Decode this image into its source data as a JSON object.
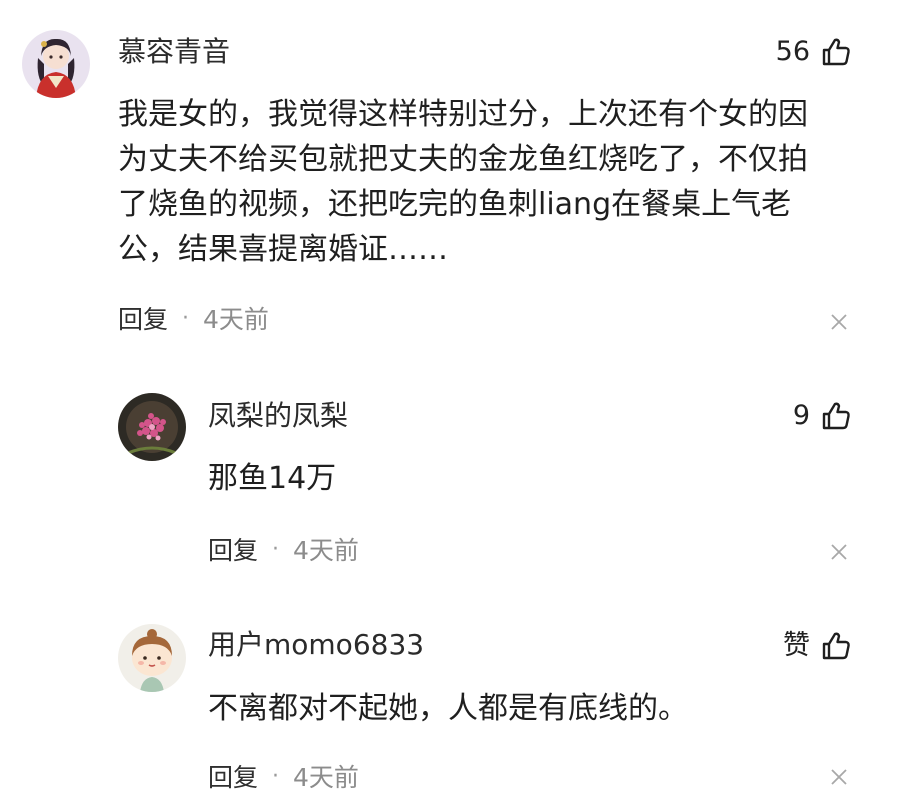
{
  "comments": [
    {
      "username": "慕容青音",
      "likes": "56",
      "lines": [
        "我是女的，我觉得这样特别过分，上次还有个女的因",
        "为丈夫不给买包就把丈夫的金龙鱼红烧吃了，不仅拍",
        "了烧鱼的视频，还把吃完的鱼刺liang在餐桌上气老",
        "公，结果喜提离婚证……"
      ],
      "reply_label": "回复",
      "separator": "·",
      "time": "4天前",
      "avatar_icon": "anime-girl-avatar"
    },
    {
      "username": "凤梨的凤梨",
      "likes": "9",
      "lines": [
        "那鱼14万"
      ],
      "reply_label": "回复",
      "separator": "·",
      "time": "4天前",
      "avatar_icon": "flower-avatar"
    },
    {
      "username": "用户momo6833",
      "likes": "赞",
      "lines": [
        "不离都对不起她，人都是有底线的。"
      ],
      "reply_label": "回复",
      "separator": "·",
      "time": "4天前",
      "avatar_icon": "cartoon-girl-avatar"
    }
  ],
  "icons": {
    "like": "thumbs-up-icon",
    "dismiss": "close-icon"
  },
  "colors": {
    "text": "#222222",
    "muted": "#8c8c8c",
    "background": "#ffffff"
  }
}
